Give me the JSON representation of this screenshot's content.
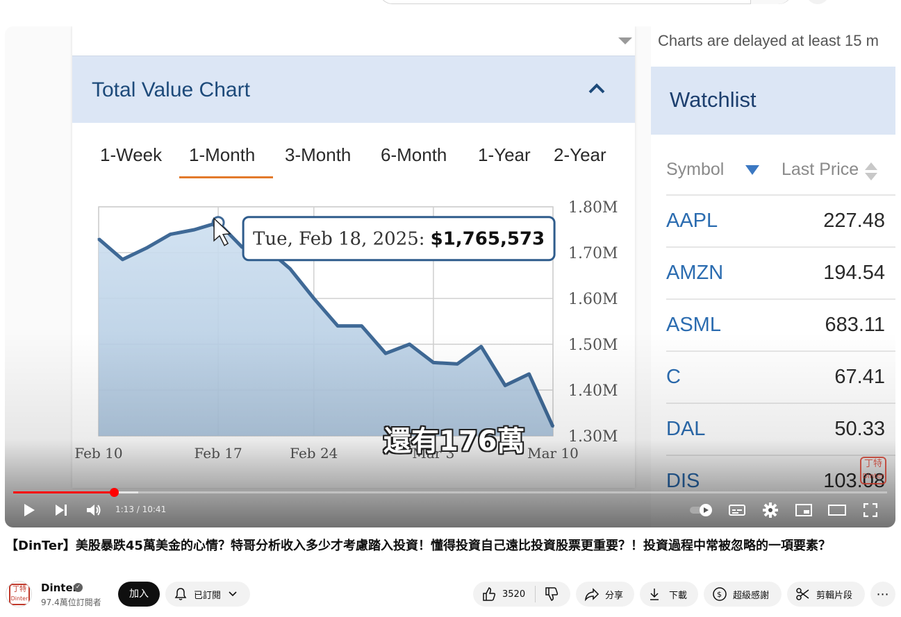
{
  "chart_panel": {
    "title": "Total Value Chart",
    "ranges": [
      "1-Week",
      "1-Month",
      "3-Month",
      "6-Month",
      "1-Year",
      "2-Year"
    ],
    "selected_range": "1-Month",
    "tooltip": {
      "date": "Tue, Feb 18, 2025:",
      "value": "$1,765,573"
    }
  },
  "chart_data": {
    "type": "area",
    "title": "Total Value Chart",
    "x_ticks": [
      "Feb 10",
      "Feb 17",
      "Feb 24",
      "Mar 3",
      "Mar 10"
    ],
    "y_ticks": [
      "1.80M",
      "1.70M",
      "1.60M",
      "1.50M",
      "1.40M",
      "1.30M"
    ],
    "ylim": [
      1300000,
      1800000
    ],
    "grid": true,
    "series": [
      {
        "x": [
          "Feb 10",
          "Feb 11",
          "Feb 12",
          "Feb 13",
          "Feb 14",
          "Feb 18",
          "Feb 19",
          "Feb 20",
          "Feb 21",
          "Feb 24",
          "Feb 25",
          "Feb 26",
          "Feb 27",
          "Feb 28",
          "Mar 3",
          "Mar 4",
          "Mar 5",
          "Mar 6",
          "Mar 7",
          "Mar 10"
        ],
        "values": [
          1730000,
          1685000,
          1710000,
          1740000,
          1750000,
          1765573,
          1712000,
          1710000,
          1665000,
          1600000,
          1540000,
          1540000,
          1480000,
          1500000,
          1460000,
          1457000,
          1495000,
          1410000,
          1435000,
          1320000
        ]
      }
    ],
    "colors": {
      "line": "#3f6996",
      "fill_top": "#cddff0",
      "fill_bottom": "#a9c3dc"
    }
  },
  "watchlist": {
    "delay_note": "Charts are delayed at least 15 m",
    "title": "Watchlist",
    "col_symbol": "Symbol",
    "col_last_price": "Last Price",
    "rows": [
      {
        "symbol": "AAPL",
        "price": "227.48"
      },
      {
        "symbol": "AMZN",
        "price": "194.54"
      },
      {
        "symbol": "ASML",
        "price": "683.11"
      },
      {
        "symbol": "C",
        "price": "67.41"
      },
      {
        "symbol": "DAL",
        "price": "50.33"
      },
      {
        "symbol": "DIS",
        "price": "103.08"
      }
    ]
  },
  "overlay": {
    "subtitle": "還有176萬",
    "stamp_text": "丁特"
  },
  "player": {
    "time": "1:13 / 10:41",
    "progress": 0.115,
    "icons": [
      "play-icon",
      "next-icon",
      "volume-icon",
      "autoplay-toggle-icon",
      "captions-icon",
      "settings-icon",
      "miniplayer-icon",
      "theater-icon",
      "fullscreen-icon"
    ]
  },
  "video": {
    "title": "【DinTer】美股暴跌45萬美金的心情？特哥分析收入多少才考慮踏入投資！懂得投資自己遠比投資股票更重要？！投資過程中常被忽略的一項要素？",
    "channel": "Dinter",
    "subscribers": "97.4萬位訂閱者",
    "avatar_text": "丁特",
    "join": "加入",
    "subscribed": "已訂閱",
    "likes": "3520",
    "share": "分享",
    "download": "下載",
    "thanks": "超級感謝",
    "clip": "剪輯片段"
  }
}
